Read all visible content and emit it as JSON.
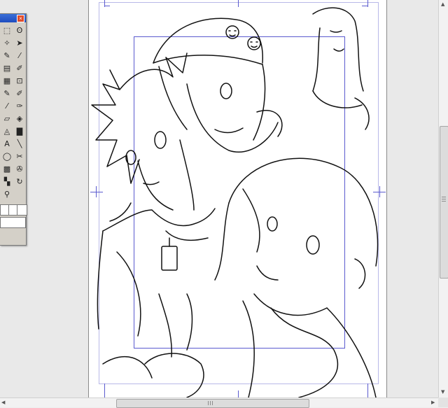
{
  "app": {
    "accent_color": "#5a5acf",
    "palette_title_color": "#1f4cbf"
  },
  "palette": {
    "close_glyph": "×",
    "tools": [
      {
        "name": "marquee-rect-icon",
        "glyph": "⬚"
      },
      {
        "name": "lasso-icon",
        "glyph": "ʘ"
      },
      {
        "name": "magic-wand-icon",
        "glyph": "✧"
      },
      {
        "name": "move-icon",
        "glyph": "➤"
      },
      {
        "name": "pen-selection-icon",
        "glyph": "✎"
      },
      {
        "name": "eyedropper-icon",
        "glyph": "⁄"
      },
      {
        "name": "layer-move-icon",
        "glyph": "▤"
      },
      {
        "name": "ruler-pen-icon",
        "glyph": "✐"
      },
      {
        "name": "grid-icon",
        "glyph": "▦"
      },
      {
        "name": "transform-icon",
        "glyph": "⊡"
      },
      {
        "name": "pencil-icon",
        "glyph": "✎"
      },
      {
        "name": "marker-icon",
        "glyph": "✐"
      },
      {
        "name": "brush-icon",
        "glyph": "⁄"
      },
      {
        "name": "airbrush-icon",
        "glyph": "✑"
      },
      {
        "name": "eraser-icon",
        "glyph": "▱"
      },
      {
        "name": "fill-icon",
        "glyph": "◈"
      },
      {
        "name": "bucket-icon",
        "glyph": "◬"
      },
      {
        "name": "gradient-icon",
        "glyph": "▇"
      },
      {
        "name": "text-icon",
        "glyph": "A"
      },
      {
        "name": "line-icon",
        "glyph": "╲"
      },
      {
        "name": "ellipse-icon",
        "glyph": "◯"
      },
      {
        "name": "balloon-icon",
        "glyph": "✂"
      },
      {
        "name": "tone-icon",
        "glyph": "▩"
      },
      {
        "name": "stamp-icon",
        "glyph": "✇"
      },
      {
        "name": "pattern-icon",
        "glyph": "▚"
      },
      {
        "name": "rotate-icon",
        "glyph": "↻"
      },
      {
        "name": "zoom-icon",
        "glyph": "⚲"
      }
    ]
  },
  "scrollbars": {
    "up_arrow": "▲",
    "down_arrow": "▼",
    "left_arrow": "◀",
    "right_arrow": "▶"
  }
}
